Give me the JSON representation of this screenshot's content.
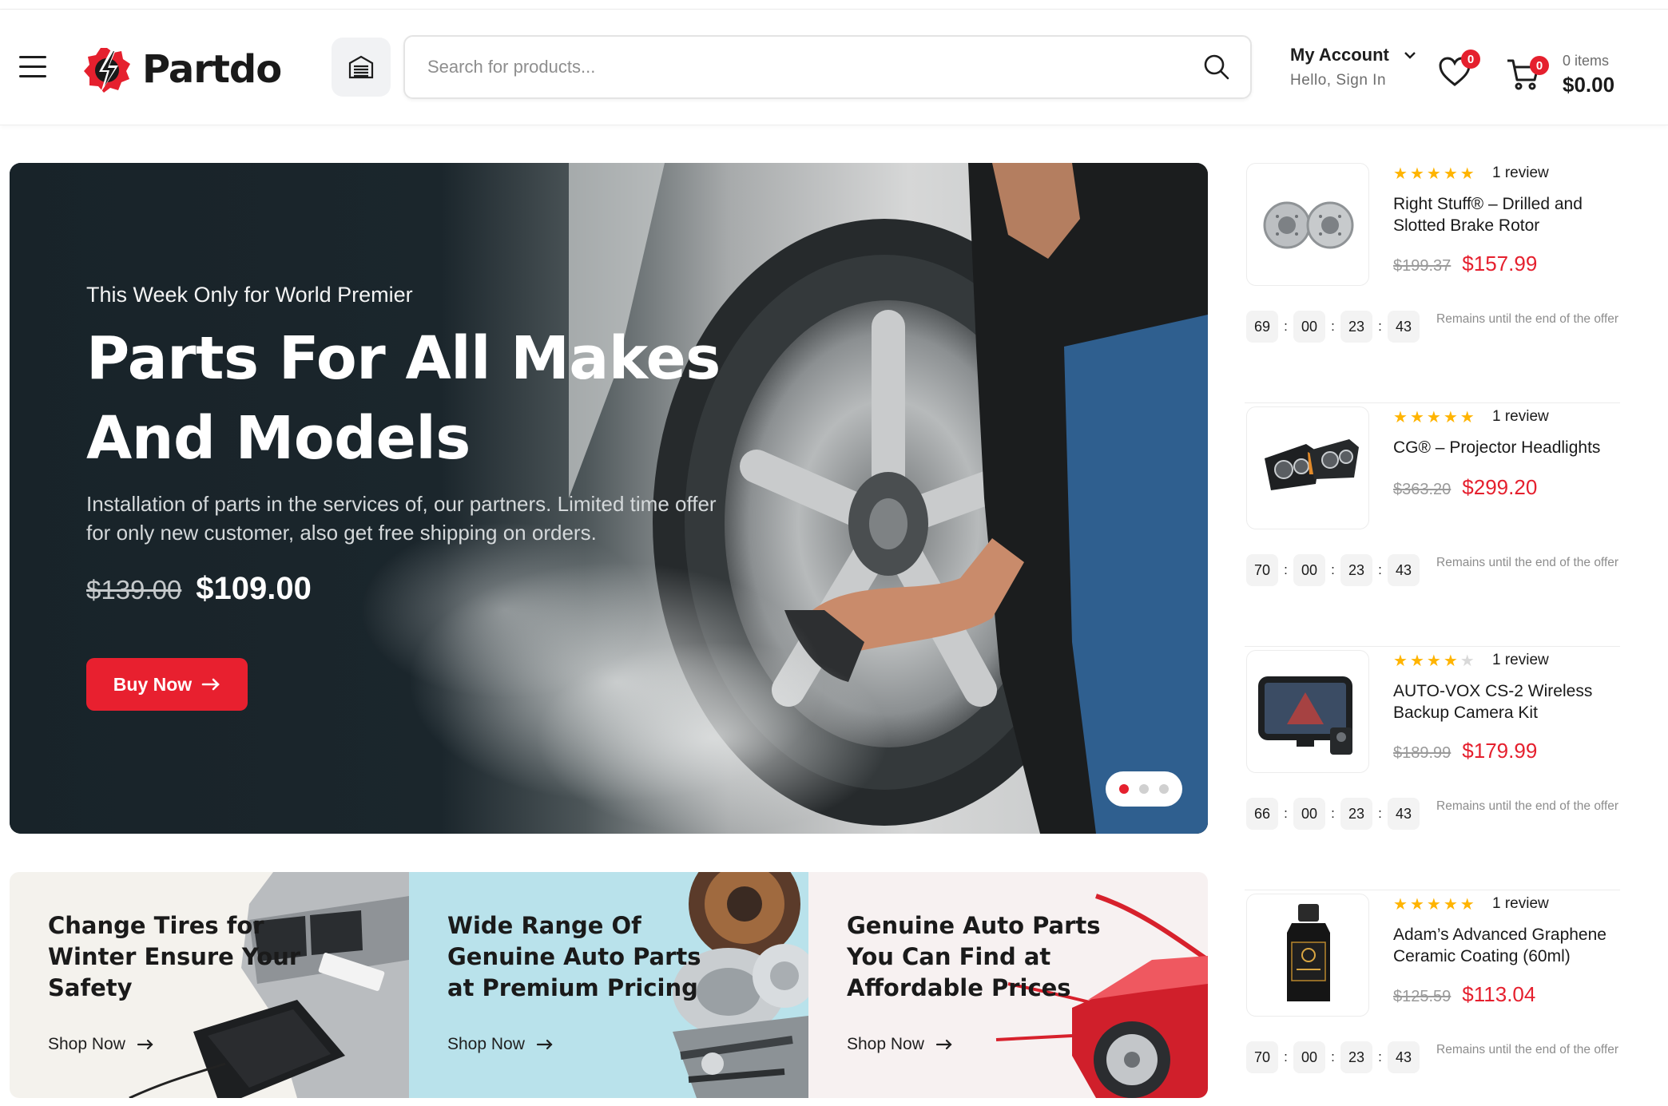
{
  "header": {
    "brand": "Partdo",
    "search_placeholder": "Search for products...",
    "account_title": "My Account",
    "account_sub": "Hello, Sign In",
    "wishlist_count": "0",
    "cart_count": "0",
    "cart_items": "0 items",
    "cart_total": "$0.00"
  },
  "hero": {
    "kicker": "This Week Only for World Premier",
    "title_line1": "Parts For All Makes",
    "title_line2": "And Models",
    "description": "Installation of parts in the services of, our partners. Limited time offer for only new customer, also get free shipping on orders.",
    "old_price": "$139.00",
    "new_price": "$109.00",
    "button": "Buy Now",
    "slides": 3,
    "active_slide": 1
  },
  "promos": [
    {
      "title": "Change Tires for Winter Ensure Your Safety",
      "link": "Shop Now",
      "bg": "#f4f2ed"
    },
    {
      "title": "Wide Range Of Genuine Auto Parts at Premium Pricing",
      "link": "Shop Now",
      "bg": "#b9e2eb"
    },
    {
      "title": "Genuine Auto Parts You Can Find at Affordable Prices",
      "link": "Shop Now",
      "bg": "#f7f1f1"
    }
  ],
  "deals": [
    {
      "name": "Right Stuff® – Drilled and Slotted Brake Rotor",
      "rating": 5,
      "reviews": "1 review",
      "old_price": "$199.37",
      "new_price": "$157.99",
      "timer": [
        "69",
        "00",
        "23",
        "43"
      ],
      "remain": "Remains until the end of the offer",
      "image": "brake-rotor"
    },
    {
      "name": "CG® – Projector Headlights",
      "rating": 5,
      "reviews": "1 review",
      "old_price": "$363.20",
      "new_price": "$299.20",
      "timer": [
        "70",
        "00",
        "23",
        "43"
      ],
      "remain": "Remains until the end of the offer",
      "image": "headlights"
    },
    {
      "name": "AUTO-VOX CS-2 Wireless Backup Camera Kit",
      "rating": 4,
      "reviews": "1 review",
      "old_price": "$189.99",
      "new_price": "$179.99",
      "timer": [
        "66",
        "00",
        "23",
        "43"
      ],
      "remain": "Remains until the end of the offer",
      "image": "camera-kit"
    },
    {
      "name": "Adam’s Advanced Graphene Ceramic Coating (60ml)",
      "rating": 5,
      "reviews": "1 review",
      "old_price": "$125.59",
      "new_price": "$113.04",
      "timer": [
        "70",
        "00",
        "23",
        "43"
      ],
      "remain": "Remains until the end of the offer",
      "image": "coating-bottle"
    }
  ],
  "colors": {
    "accent": "#e5202e",
    "hero_bg": "#182329",
    "star": "#ffb400"
  }
}
